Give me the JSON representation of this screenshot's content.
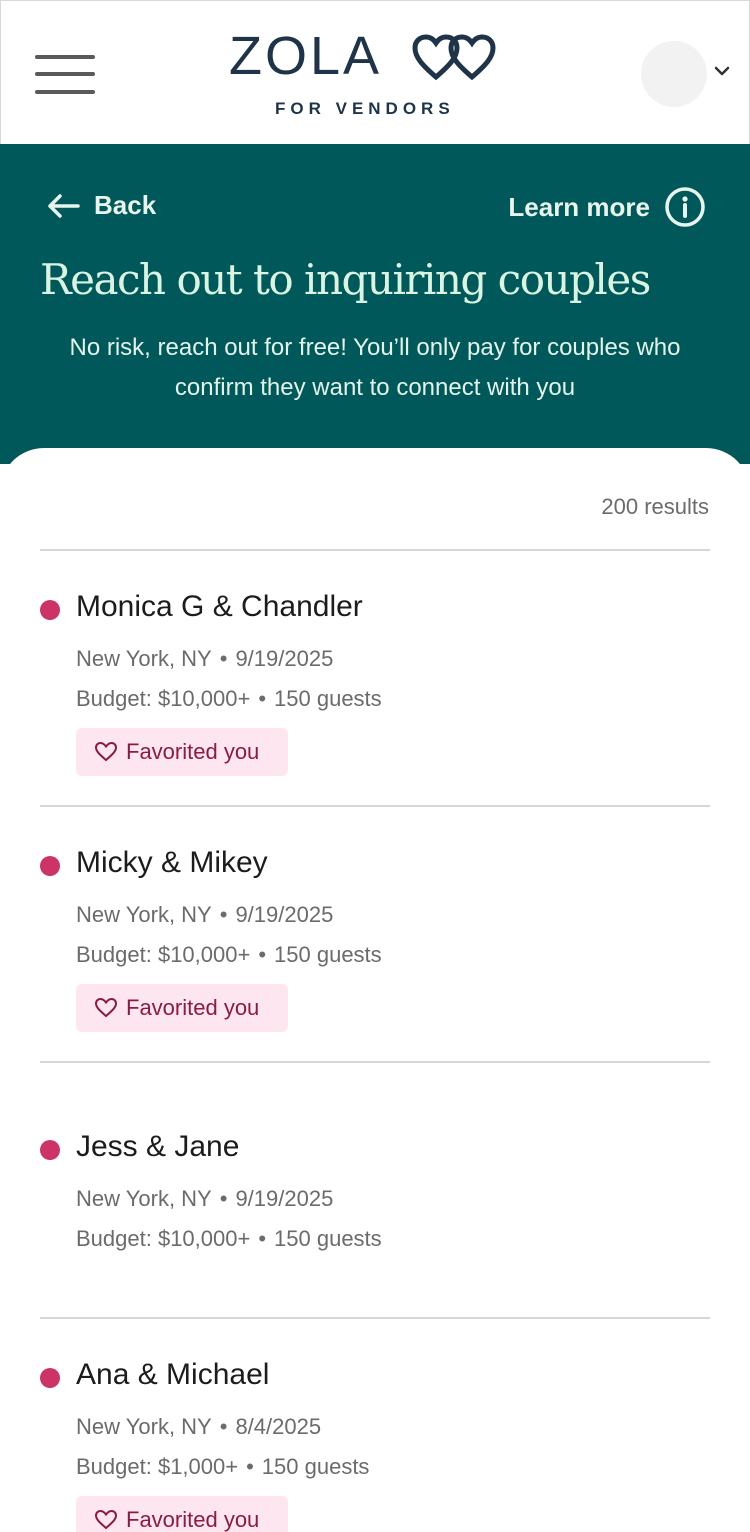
{
  "header": {
    "logo_word": "ZOLA",
    "logo_sub": "FOR VENDORS",
    "menu_icon": "hamburger-menu-icon",
    "avatar_icon": "user-avatar",
    "chevron_icon": "chevron-down-icon"
  },
  "hero": {
    "back_label": "Back",
    "learn_more_label": "Learn more",
    "title": "Reach out to inquiring couples",
    "subtitle": "No risk, reach out for free! You’ll only pay for couples who confirm they want to connect with you"
  },
  "list": {
    "results_count": "200 results",
    "items": [
      {
        "names": "Monica G & Chandler",
        "location": "New York, NY",
        "date": "9/19/2025",
        "budget": "Budget: $10,000+",
        "guests": "150 guests",
        "badge": "Favorited you"
      },
      {
        "names": "Micky & Mikey",
        "location": "New York, NY",
        "date": "9/19/2025",
        "budget": "Budget: $10,000+",
        "guests": "150 guests",
        "badge": "Favorited you"
      },
      {
        "names": "Jess & Jane",
        "location": "New York, NY",
        "date": "9/19/2025",
        "budget": "Budget: $10,000+",
        "guests": "150 guests",
        "badge": null
      },
      {
        "names": "Ana & Michael",
        "location": "New York, NY",
        "date": "8/4/2025",
        "budget": "Budget: $1,000+",
        "guests": "150 guests",
        "badge": "Favorited you"
      }
    ]
  },
  "colors": {
    "hero_bg": "#00585a",
    "hero_text": "#d9f4e2",
    "dot": "#cc3366",
    "badge_bg": "#fde6f0",
    "badge_text": "#8a1b45",
    "logo": "#1f3448"
  }
}
